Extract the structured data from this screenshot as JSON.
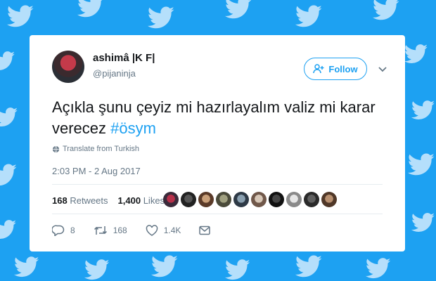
{
  "tweet": {
    "display_name": "ashimâ |K F|",
    "handle": "@pijaninja",
    "follow_label": "Follow",
    "text": "Açıkla şunu çeyiz mi hazırlayalım valiz mi karar verecez ",
    "hashtag": "#ösym",
    "translate_label": "Translate from Turkish",
    "timestamp": "2:03 PM - 2 Aug 2017",
    "retweets_count": "168",
    "retweets_label": "Retweets",
    "likes_count": "1,400",
    "likes_label": "Likes",
    "reply_count": "8",
    "retweet_action_count": "168",
    "like_action_count": "1.4K"
  },
  "colors": {
    "brand": "#1da1f2",
    "background": "#1da1f2",
    "text": "#14171a",
    "muted": "#657786"
  },
  "icons": [
    "follow-person-plus-icon",
    "chevron-down-icon",
    "globe-icon",
    "reply-icon",
    "retweet-icon",
    "heart-icon",
    "direct-message-icon"
  ]
}
